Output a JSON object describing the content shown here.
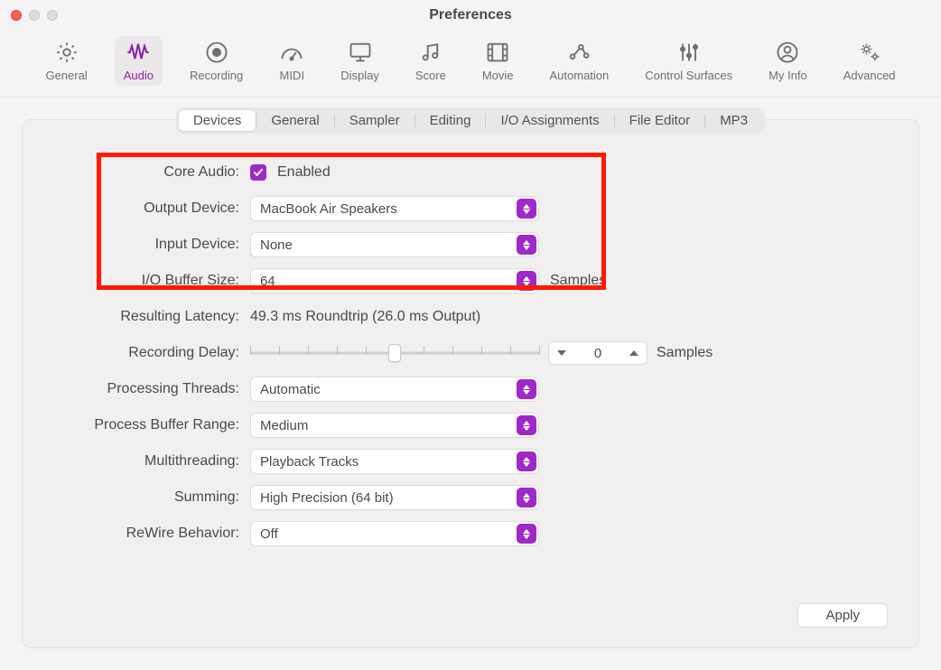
{
  "window": {
    "title": "Preferences"
  },
  "toolbar": {
    "items": [
      {
        "id": "general",
        "label": "General",
        "icon": "gear"
      },
      {
        "id": "audio",
        "label": "Audio",
        "icon": "waveform",
        "active": true
      },
      {
        "id": "recording",
        "label": "Recording",
        "icon": "record"
      },
      {
        "id": "midi",
        "label": "MIDI",
        "icon": "gauge"
      },
      {
        "id": "display",
        "label": "Display",
        "icon": "monitor"
      },
      {
        "id": "score",
        "label": "Score",
        "icon": "notes"
      },
      {
        "id": "movie",
        "label": "Movie",
        "icon": "film"
      },
      {
        "id": "automation",
        "label": "Automation",
        "icon": "automation"
      },
      {
        "id": "control-surfaces",
        "label": "Control Surfaces",
        "icon": "sliders"
      },
      {
        "id": "my-info",
        "label": "My Info",
        "icon": "person"
      },
      {
        "id": "advanced",
        "label": "Advanced",
        "icon": "gears"
      }
    ]
  },
  "subtabs": {
    "items": [
      {
        "id": "devices",
        "label": "Devices",
        "active": true
      },
      {
        "id": "general",
        "label": "General"
      },
      {
        "id": "sampler",
        "label": "Sampler"
      },
      {
        "id": "editing",
        "label": "Editing"
      },
      {
        "id": "io-assignments",
        "label": "I/O Assignments"
      },
      {
        "id": "file-editor",
        "label": "File Editor"
      },
      {
        "id": "mp3",
        "label": "MP3"
      }
    ]
  },
  "form": {
    "core_audio": {
      "label": "Core Audio:",
      "checkbox_label": "Enabled",
      "checked": true
    },
    "output_device": {
      "label": "Output Device:",
      "value": "MacBook Air Speakers"
    },
    "input_device": {
      "label": "Input Device:",
      "value": "None"
    },
    "io_buffer": {
      "label": "I/O Buffer Size:",
      "value": "64",
      "suffix": "Samples"
    },
    "resulting_latency": {
      "label": "Resulting Latency:",
      "value": "49.3 ms Roundtrip (26.0 ms Output)"
    },
    "recording_delay": {
      "label": "Recording Delay:",
      "value": "0",
      "suffix": "Samples"
    },
    "processing_threads": {
      "label": "Processing Threads:",
      "value": "Automatic"
    },
    "process_buffer_range": {
      "label": "Process Buffer Range:",
      "value": "Medium"
    },
    "multithreading": {
      "label": "Multithreading:",
      "value": "Playback Tracks"
    },
    "summing": {
      "label": "Summing:",
      "value": "High Precision (64 bit)"
    },
    "rewire": {
      "label": "ReWire Behavior:",
      "value": "Off"
    }
  },
  "buttons": {
    "apply": "Apply"
  },
  "colors": {
    "accent": "#a028c8",
    "highlight": "#ff1a00"
  }
}
